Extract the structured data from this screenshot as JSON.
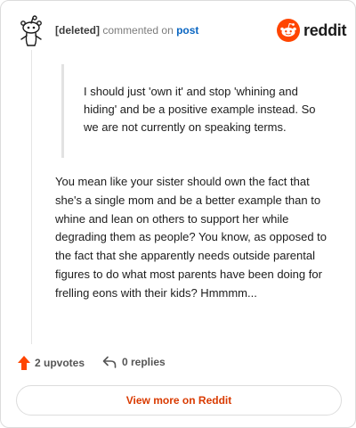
{
  "comment": {
    "username": "[deleted]",
    "action_text": "commented on",
    "post_link": "post",
    "quote": "I should just 'own it' and stop 'whining and hiding' and be a positive example instead. So we are not currently on speaking terms.",
    "body": "You mean like your sister should own the fact that she's a single mom and be a better example than to whine and lean on others to support her while degrading them as people? You know, as opposed to the fact that she apparently needs outside parental figures to do what most parents have been doing for frelling eons with their kids? Hmmmm..."
  },
  "brand": {
    "logo_text": "reddit",
    "accent": "#ff4500"
  },
  "footer": {
    "upvotes_label": "2 upvotes",
    "replies_label": "0 replies",
    "view_more_label": "View more on Reddit"
  },
  "colors": {
    "link": "#0a66c2",
    "view_more": "#d93a00",
    "upvote_arrow": "#ff4500"
  }
}
